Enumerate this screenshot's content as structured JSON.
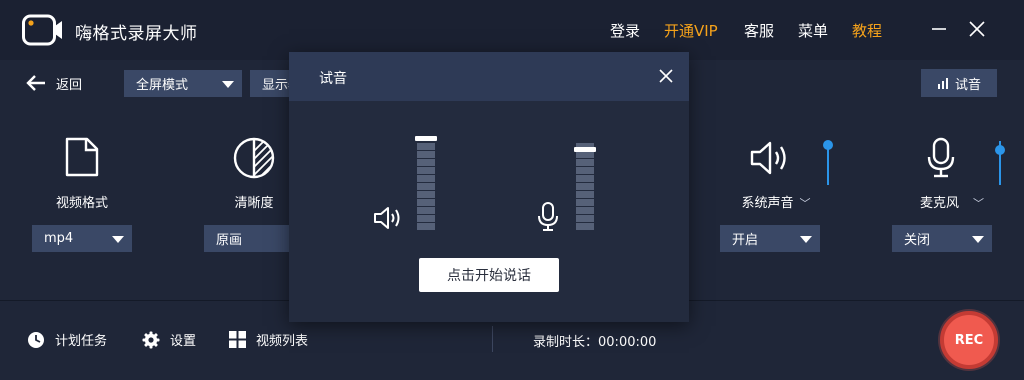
{
  "app": {
    "title": "嗨格式录屏大师",
    "accent_color": "#f5a21b",
    "bg_color": "#1f2638"
  },
  "header": {
    "menu": [
      {
        "label": "登录",
        "color": "#ffffff"
      },
      {
        "label": "开通VIP",
        "color": "#f5a21b"
      },
      {
        "label": "客服",
        "color": "#ffffff"
      },
      {
        "label": "菜单",
        "color": "#ffffff"
      },
      {
        "label": "教程",
        "color": "#f5a21b"
      }
    ],
    "window_controls": [
      "minimize-icon",
      "close-icon"
    ]
  },
  "toolbar": {
    "back_label": "返回",
    "mode_select": {
      "value": "全屏模式"
    },
    "display_select": {
      "value": "显示器"
    },
    "test_button_label": "试音"
  },
  "features": {
    "video_format": {
      "label": "视频格式",
      "icon": "file-icon",
      "value": "mp4"
    },
    "clarity": {
      "label": "清晰度",
      "icon": "contrast-icon",
      "value": "原画"
    },
    "system_sound": {
      "label": "系统声音",
      "icon": "speaker-icon",
      "value": "开启",
      "volume_level": 0.9
    },
    "microphone": {
      "label": "麦克风",
      "icon": "microphone-icon",
      "value": "关闭",
      "volume_level": 0.8
    }
  },
  "bottom": {
    "schedule_label": "计划任务",
    "settings_label": "设置",
    "video_list_label": "视频列表",
    "record_time_label": "录制时长：",
    "record_time_value": "00:00:00",
    "rec_label": "REC",
    "rec_color": "#f05a4f"
  },
  "dialog": {
    "title": "试音",
    "speaker_level": 1.0,
    "mic_level": 0.88,
    "start_button_label": "点击开始说话"
  }
}
